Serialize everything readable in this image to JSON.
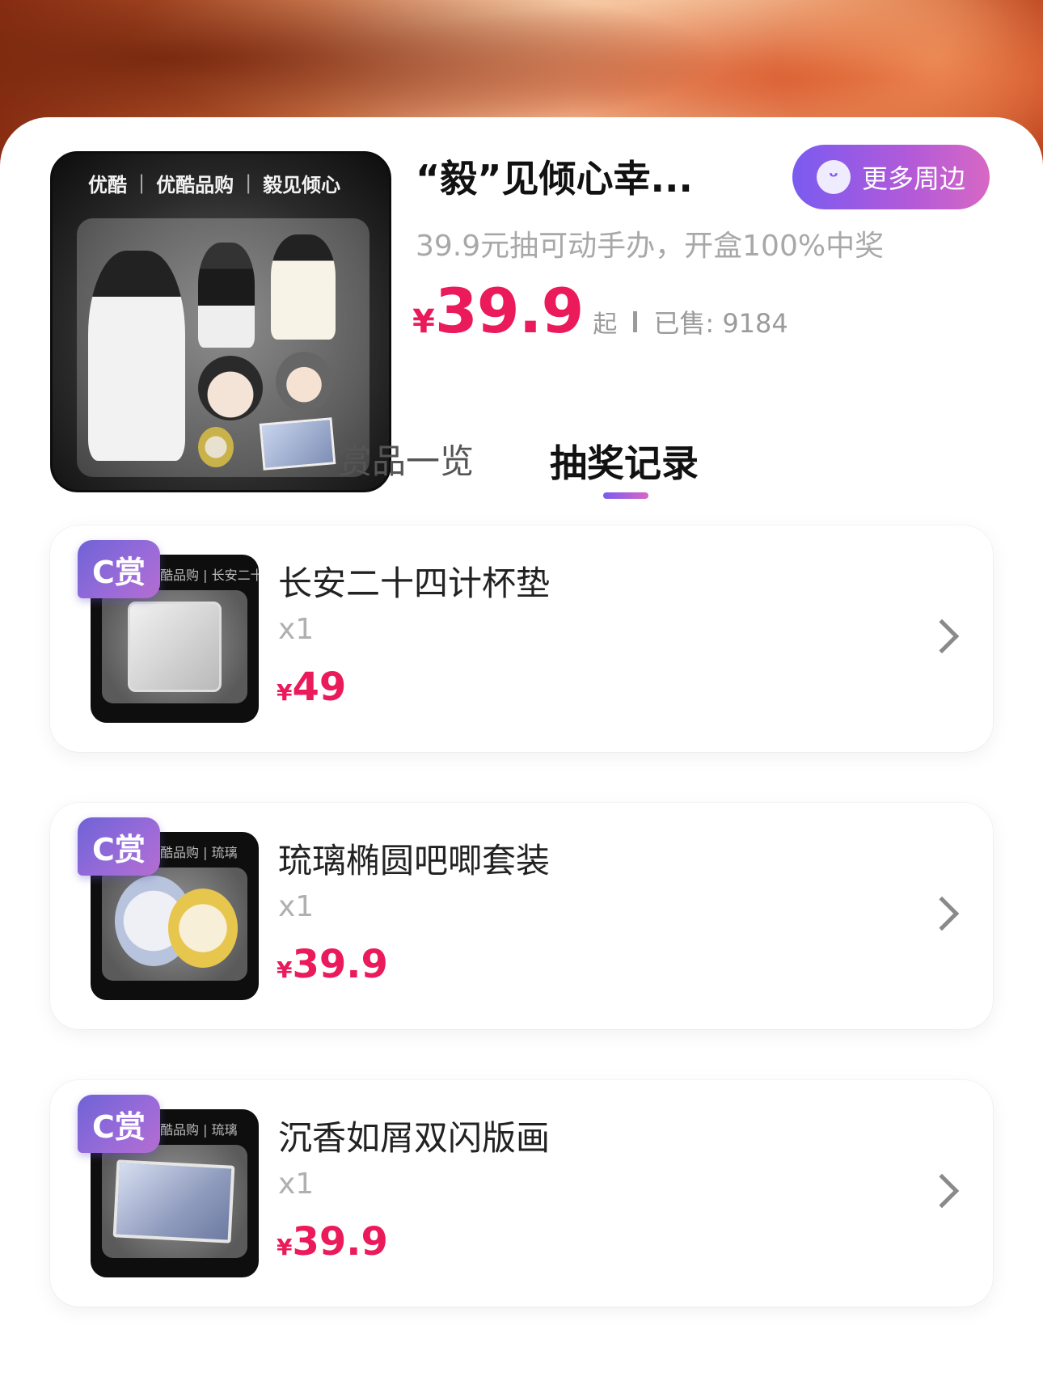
{
  "product": {
    "title": "“毅”见倾心幸...",
    "subtitle": "39.9元抽可动手办，开盒100%中奖",
    "price_symbol": "¥",
    "price": "39.9",
    "price_suffix": "起",
    "sold_label": "已售: 9184",
    "cover_brand": [
      "优酷",
      "优酷品购",
      "毅见倾心"
    ],
    "more_button_label": "更多周边",
    "more_button_icon": "smile-icon"
  },
  "tabs": [
    {
      "label": "赏品一览",
      "active": false
    },
    {
      "label": "抽奖记录",
      "active": true
    }
  ],
  "records": [
    {
      "tag": "C赏",
      "name": "长安二十四计杯垫",
      "qty": "x1",
      "price_symbol": "¥",
      "price": "49",
      "thumb_brand": "优酷品购 | 长安二十四计"
    },
    {
      "tag": "C赏",
      "name": "琉璃椭圆吧唧套装",
      "qty": "x1",
      "price_symbol": "¥",
      "price": "39.9",
      "thumb_brand": "优酷品购 | 琉璃"
    },
    {
      "tag": "C赏",
      "name": "沉香如屑双闪版画",
      "qty": "x1",
      "price_symbol": "¥",
      "price": "39.9",
      "thumb_brand": "优酷品购 | 琉璃"
    }
  ],
  "colors": {
    "accent_price": "#ea1a5b",
    "accent_purple": "#7a5bf0",
    "accent_pink": "#d768c4"
  }
}
